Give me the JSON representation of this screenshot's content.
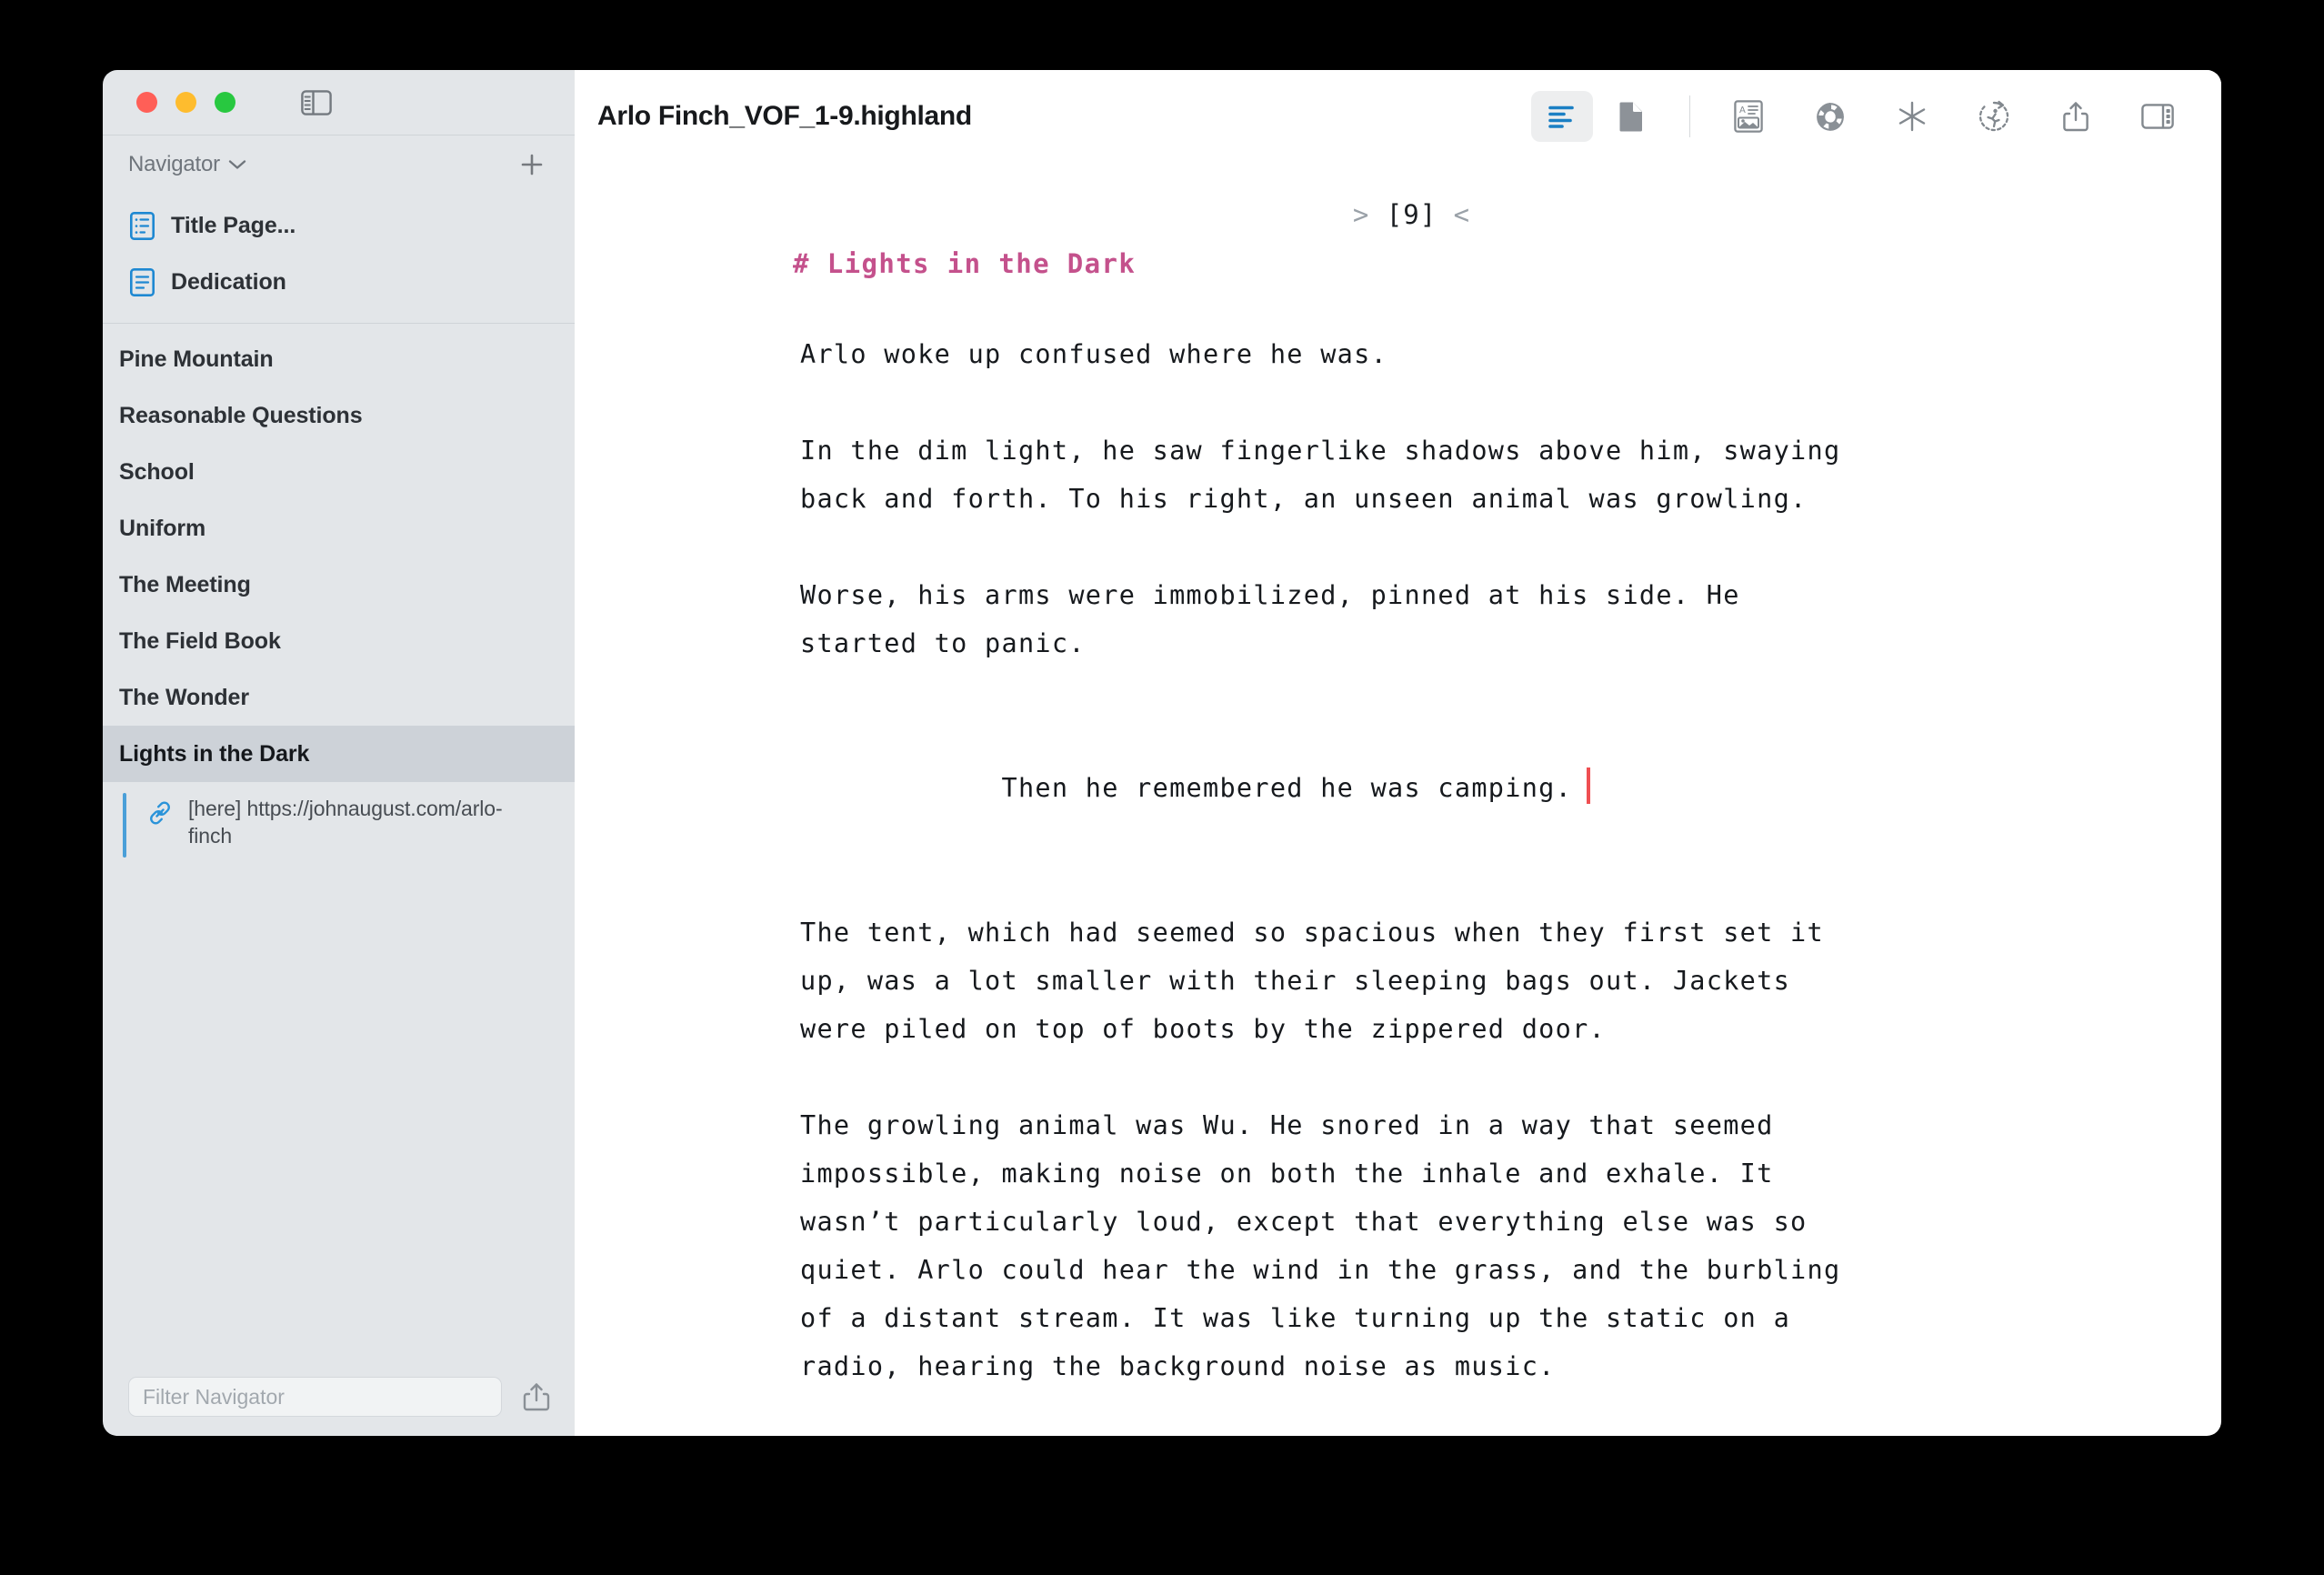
{
  "window": {
    "traffic_lights": [
      "close",
      "minimize",
      "zoom"
    ],
    "sidebar_toggle_icon": "sidebar-toggle-icon"
  },
  "sidebar": {
    "header": {
      "label": "Navigator",
      "chevron_icon": "chevron-down-icon",
      "add_icon": "plus-icon"
    },
    "documents": [
      {
        "label": "Title Page...",
        "icon": "document-icon"
      },
      {
        "label": "Dedication",
        "icon": "document-icon"
      }
    ],
    "chapters": [
      {
        "label": "Pine Mountain",
        "selected": false
      },
      {
        "label": "Reasonable Questions",
        "selected": false
      },
      {
        "label": "School",
        "selected": false
      },
      {
        "label": "Uniform",
        "selected": false
      },
      {
        "label": "The Meeting",
        "selected": false
      },
      {
        "label": "The Field Book",
        "selected": false
      },
      {
        "label": "The Wonder",
        "selected": false
      },
      {
        "label": "Lights in the Dark",
        "selected": true
      }
    ],
    "link_item": {
      "icon": "link-icon",
      "text": "[here] https://johnaugust.com/arlo-finch"
    },
    "filter": {
      "placeholder": "Filter Navigator",
      "value": "",
      "export_icon": "share-icon"
    }
  },
  "toolbar": {
    "title": "Arlo Finch_VOF_1-9.highland",
    "buttons": [
      {
        "name": "editor-view-button",
        "icon": "text-lines-icon",
        "active": true
      },
      {
        "name": "preview-view-button",
        "icon": "page-icon",
        "active": false
      },
      {
        "name": "assets-button",
        "icon": "image-text-icon",
        "active": false
      },
      {
        "name": "theme-button",
        "icon": "color-wheel-icon",
        "active": false
      },
      {
        "name": "sprint-button",
        "icon": "asterisk-icon",
        "active": false
      },
      {
        "name": "revision-button",
        "icon": "runner-timer-icon",
        "active": false
      },
      {
        "name": "share-button",
        "icon": "share-icon",
        "active": false
      },
      {
        "name": "inspector-toggle-button",
        "icon": "right-panel-icon",
        "active": false
      }
    ]
  },
  "editor": {
    "page_marker": {
      "left_arrow": ">",
      "number": "[9]",
      "right_arrow": "<"
    },
    "heading": {
      "hash": "#",
      "text": "Lights in the Dark"
    },
    "paragraphs": [
      "Arlo woke up confused where he was.",
      "In the dim light, he saw fingerlike shadows above him, swaying\nback and forth. To his right, an unseen animal was growling.",
      "Worse, his arms were immobilized, pinned at his side. He\nstarted to panic.",
      "Then he remembered he was camping.",
      "The tent, which had seemed so spacious when they first set it\nup, was a lot smaller with their sleeping bags out. Jackets\nwere piled on top of boots by the zippered door.",
      "The growling animal was Wu. He snored in a way that seemed\nimpossible, making noise on both the inhale and exhale. It\nwasn’t particularly loud, except that everything else was so\nquiet. Arlo could hear the wind in the grass, and the burbling\nof a distant stream. It was like turning up the static on a\nradio, hearing the background noise as music."
    ],
    "caret_after_paragraph_index": 3
  },
  "colors": {
    "sidebar_bg": "#e3e6e9",
    "selected_row": "#cdd2d8",
    "heading": "#c4518c",
    "caret": "#ef4f52",
    "accent_blue": "#1e88d2",
    "link_blue": "#4a9fd8"
  }
}
